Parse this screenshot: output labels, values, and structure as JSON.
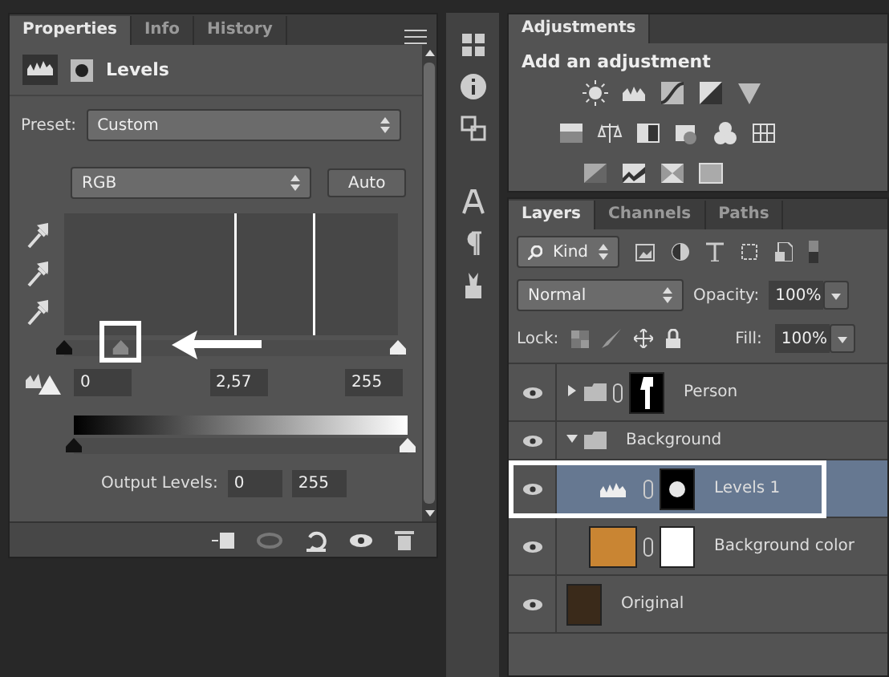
{
  "properties_panel": {
    "tabs": [
      {
        "label": "Properties",
        "selected": true
      },
      {
        "label": "Info",
        "selected": false
      },
      {
        "label": "History",
        "selected": false
      }
    ],
    "title": "Levels",
    "preset": {
      "label": "Preset:",
      "value": "Custom"
    },
    "channel": {
      "value": "RGB"
    },
    "auto_button": "Auto",
    "input_sliders": [
      {
        "kind": "black",
        "level": 0,
        "highlighted": false
      },
      {
        "kind": "gray",
        "level": 0.17,
        "highlighted": true
      },
      {
        "kind": "white",
        "level": 1,
        "highlighted": false
      }
    ],
    "input_values": [
      "0",
      "2,57",
      "255"
    ],
    "output_sliders": [
      {
        "kind": "black",
        "level": 0
      },
      {
        "kind": "white",
        "level": 1
      }
    ],
    "output_label": "Output Levels:",
    "output_values": [
      "0",
      "255"
    ]
  },
  "adjustments_panel": {
    "tabs": [
      {
        "label": "Adjustments",
        "selected": true
      }
    ],
    "heading": "Add an adjustment"
  },
  "layers_panel": {
    "tabs": [
      {
        "label": "Layers",
        "selected": true
      },
      {
        "label": "Channels",
        "selected": false
      },
      {
        "label": "Paths",
        "selected": false
      }
    ],
    "filter": "Kind",
    "blend_mode": "Normal",
    "opacity_label": "Opacity:",
    "opacity": "100%",
    "lock_label": "Lock:",
    "fill_label": "Fill:",
    "fill": "100%",
    "layers": [
      {
        "name": "Person",
        "kind": "group",
        "expanded": false,
        "selected": false,
        "visible": true,
        "highlighted": false
      },
      {
        "name": "Background",
        "kind": "group",
        "expanded": true,
        "selected": false,
        "visible": true,
        "highlighted": false,
        "children": [
          {
            "name": "Levels 1",
            "kind": "adjustment",
            "selected": true,
            "visible": true,
            "highlighted": true
          },
          {
            "name": "Background color",
            "kind": "fill",
            "selected": false,
            "visible": true,
            "highlighted": false
          }
        ]
      },
      {
        "name": "Original",
        "kind": "image",
        "selected": false,
        "visible": true,
        "highlighted": false
      }
    ]
  }
}
